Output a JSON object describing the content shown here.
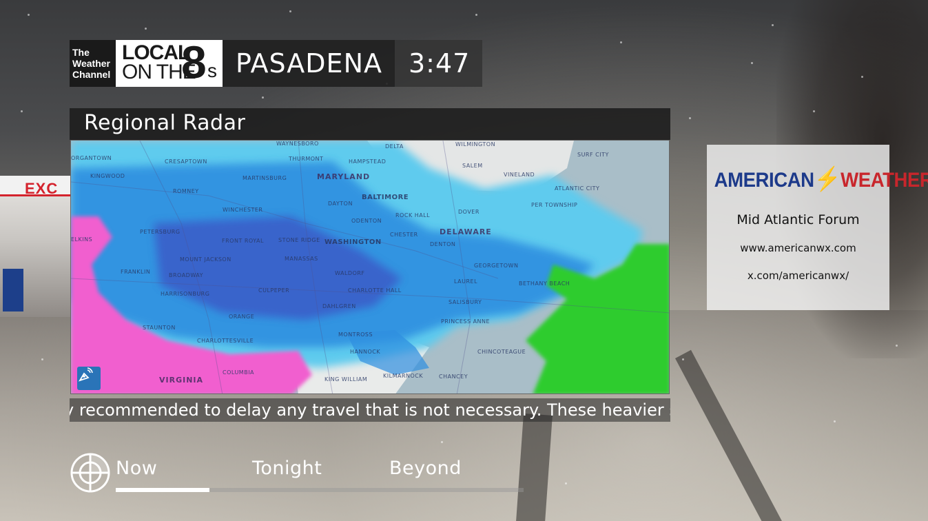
{
  "header": {
    "network_logo": [
      "The",
      "Weather",
      "Channel"
    ],
    "brand_logo": {
      "line1": "LOCAL",
      "line2": "ON THE",
      "number": "8",
      "suffix": "s"
    },
    "city": "PASADENA",
    "time": "3:47"
  },
  "panel": {
    "title": "Regional Radar",
    "map_labels": {
      "states": [
        "MARYLAND",
        "DELAWARE",
        "VIRGINIA"
      ],
      "cities_major": [
        "BALTIMORE",
        "WASHINGTON"
      ],
      "cities": [
        "WAYNESBORO",
        "DELTA",
        "WILMINGTON",
        "SURF CITY",
        "ORGANTOWN",
        "CRESAPTOWN",
        "THURMONT",
        "HAMPSTEAD",
        "SALEM",
        "VINELAND",
        "KINGWOOD",
        "MARTINSBURG",
        "ATLANTIC CITY",
        "ROMNEY",
        "DAYTON",
        "WINCHESTER",
        "ODENTON",
        "ROCK HALL",
        "DOVER",
        "PER TOWNSHIP",
        "PETERSBURG",
        "FRONT ROYAL",
        "STONE RIDGE",
        "CHESTER",
        "ELKINS",
        "DENTON",
        "FRANKLIN",
        "MANASSAS",
        "GEORGETOWN",
        "MOUNT JACKSON",
        "BROADWAY",
        "WALDORF",
        "LAUREL",
        "BETHANY BEACH",
        "HARRISONBURG",
        "CULPEPER",
        "CHARLOTTE HALL",
        "SALISBURY",
        "DAHLGREN",
        "ORANGE",
        "PRINCESS ANNE",
        "STAUNTON",
        "CHARLOTTESVILLE",
        "MONTROSS",
        "CHINCOTEAGUE",
        "HANNOCK",
        "KING WILLIAM",
        "COLUMBIA",
        "KILMARNOCK",
        "CHANCEY"
      ]
    },
    "radar_colors": {
      "snow_light": "#5fd2ee",
      "snow_mid": "#2f8fe0",
      "snow_heavy": "#3b5fc8",
      "mix": "#f15fcf",
      "rain": "#2ecc2e"
    }
  },
  "ticker": {
    "text": "y recommended to delay any travel that is not necessary. These heavier sno"
  },
  "ad": {
    "logo_left": "AMERICAN",
    "logo_right": "WEATHER",
    "forum": "Mid Atlantic Forum",
    "website": "www.americanwx.com",
    "social": "x.com/americanwx/"
  },
  "nav": {
    "icon": "radar-target-icon",
    "tabs": [
      {
        "label": "Now",
        "active": true
      },
      {
        "label": "Tonight",
        "active": false
      },
      {
        "label": "Beyond",
        "active": false
      }
    ],
    "progress": 0.23
  },
  "background": {
    "station_sign": "EXC"
  }
}
